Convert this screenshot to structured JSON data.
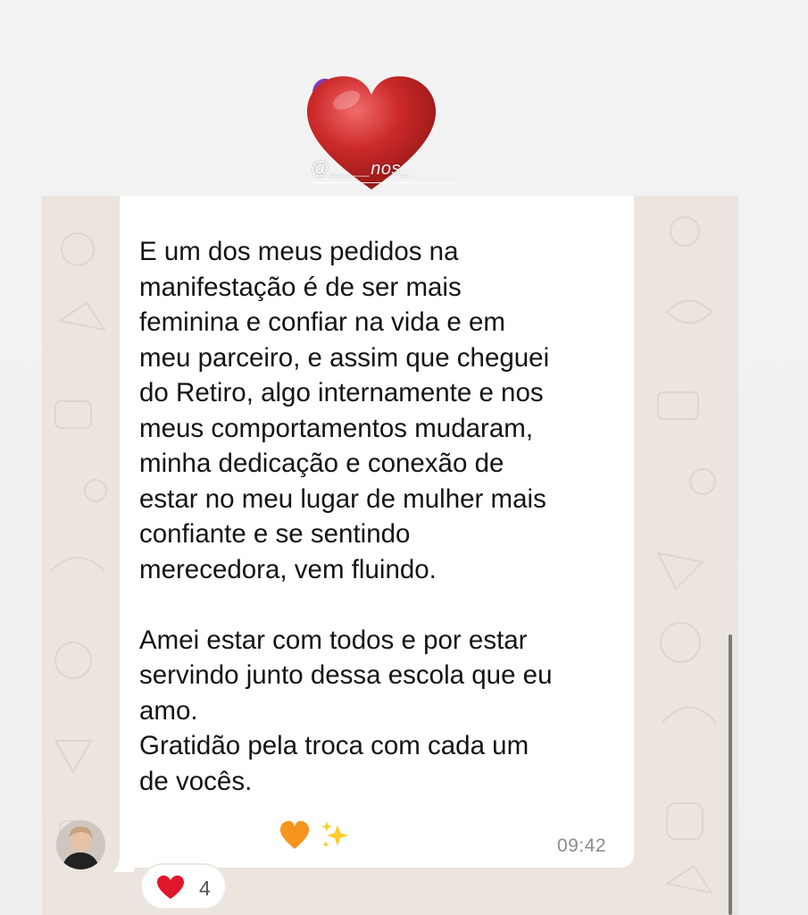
{
  "sticker": {
    "icon": "heart-3d-sticker",
    "watermark": "@____nos_"
  },
  "message": {
    "text": "E um dos meus pedidos na\nmanifestação é de ser mais\nfeminina e confiar na vida e em\nmeu parceiro, e assim que cheguei\ndo Retiro, algo internamente e nos\nmeus comportamentos mudaram,\nminha dedicação e conexão de\nestar no meu lugar de mulher mais\nconfiante e se sentindo\nmerecedora, vem fluindo.\n\nAmei estar com todos e por estar\nservindo junto dessa escola que eu\namo.\nGratidão pela troca com cada um\nde vocês.",
    "emojis": [
      "orange-heart-icon",
      "sparkles-icon"
    ],
    "time": "09:42"
  },
  "reaction": {
    "icon": "red-heart-icon",
    "count": "4"
  },
  "colors": {
    "chat_background": "#ebe5de",
    "bubble": "#ffffff",
    "timestamp": "#8c8c8c"
  }
}
